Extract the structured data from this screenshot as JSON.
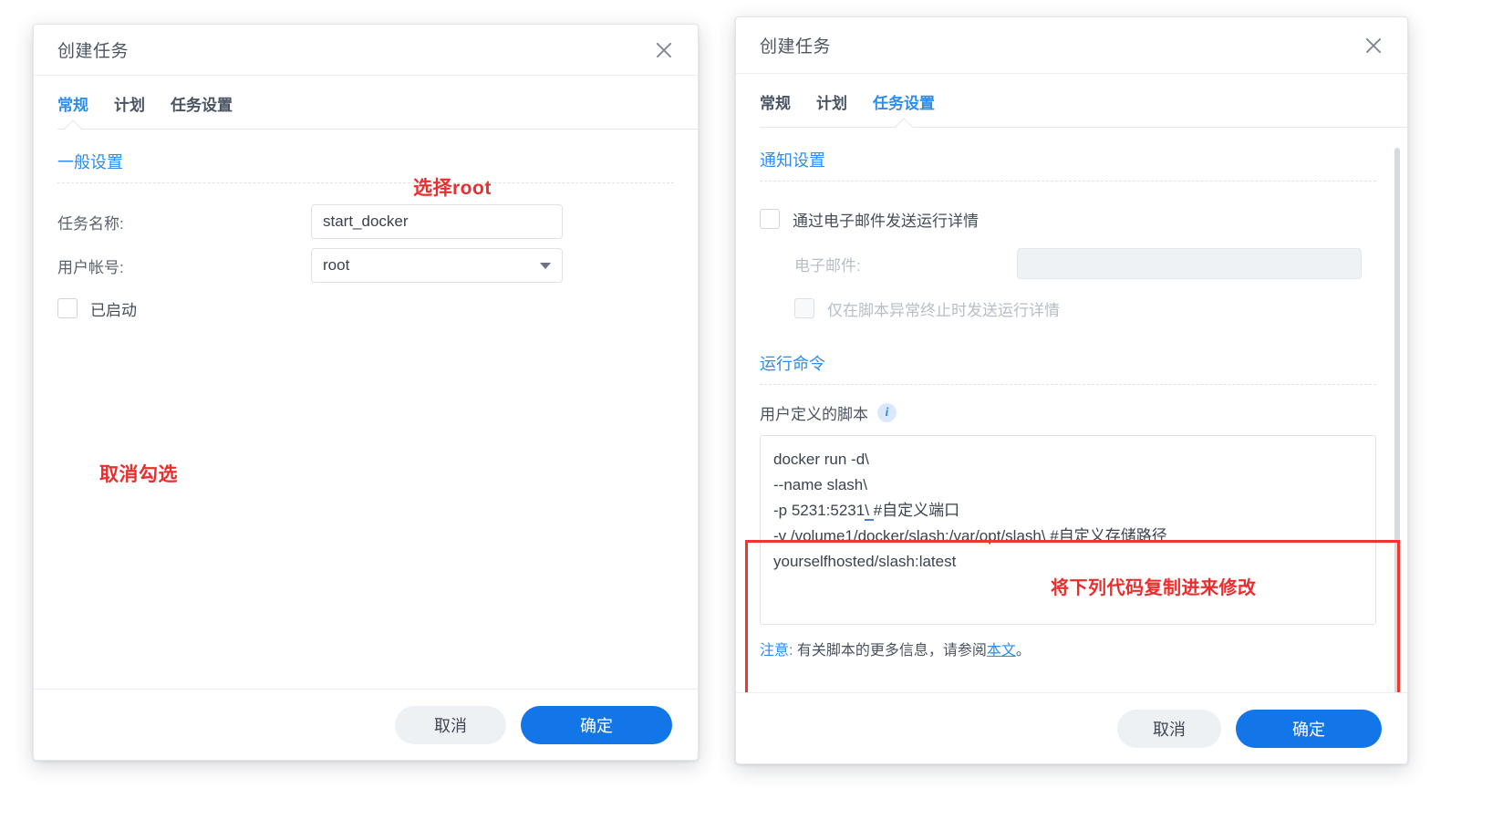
{
  "left_dialog": {
    "title": "创建任务",
    "close_icon": "close-icon",
    "tabs": [
      {
        "label": "常规",
        "active": true
      },
      {
        "label": "计划",
        "active": false
      },
      {
        "label": "任务设置",
        "active": false
      }
    ],
    "section_title": "一般设置",
    "fields": {
      "task_name_label": "任务名称:",
      "task_name_value": "start_docker",
      "user_account_label": "用户帐号:",
      "user_account_value": "root",
      "enabled_label": "已启动"
    },
    "annotations": {
      "select_root": "选择root",
      "uncheck": "取消勾选"
    },
    "footer": {
      "cancel": "取消",
      "confirm": "确定"
    }
  },
  "right_dialog": {
    "title": "创建任务",
    "close_icon": "close-icon",
    "tabs": [
      {
        "label": "常规",
        "active": false
      },
      {
        "label": "计划",
        "active": false
      },
      {
        "label": "任务设置",
        "active": true
      }
    ],
    "notify": {
      "section_title": "通知设置",
      "send_email_label": "通过电子邮件发送运行详情",
      "email_label": "电子邮件:",
      "email_value": "",
      "abnormal_only_label": "仅在脚本异常终止时发送运行详情"
    },
    "run_command": {
      "section_title": "运行命令",
      "script_label": "用户定义的脚本",
      "info_icon": "info-icon",
      "script_lines": [
        "docker run -d\\",
        "--name slash\\",
        "-p 5231:5231\\  #自定义端口",
        "-v /volume1/docker/slash:/var/opt/slash\\  #自定义存储路径",
        "yourselfhosted/slash:latest"
      ],
      "annotation": "将下列代码复制进来修改"
    },
    "note": {
      "key": "注意:",
      "text": " 有关脚本的更多信息，请参阅",
      "link": "本文",
      "suffix": "。"
    },
    "footer": {
      "cancel": "取消",
      "confirm": "确定"
    }
  },
  "colors": {
    "accent_blue": "#2d8cf0",
    "button_blue": "#1376e8",
    "annotation_red": "#ed2d2d",
    "highlight_box_red": "#f1372b"
  }
}
